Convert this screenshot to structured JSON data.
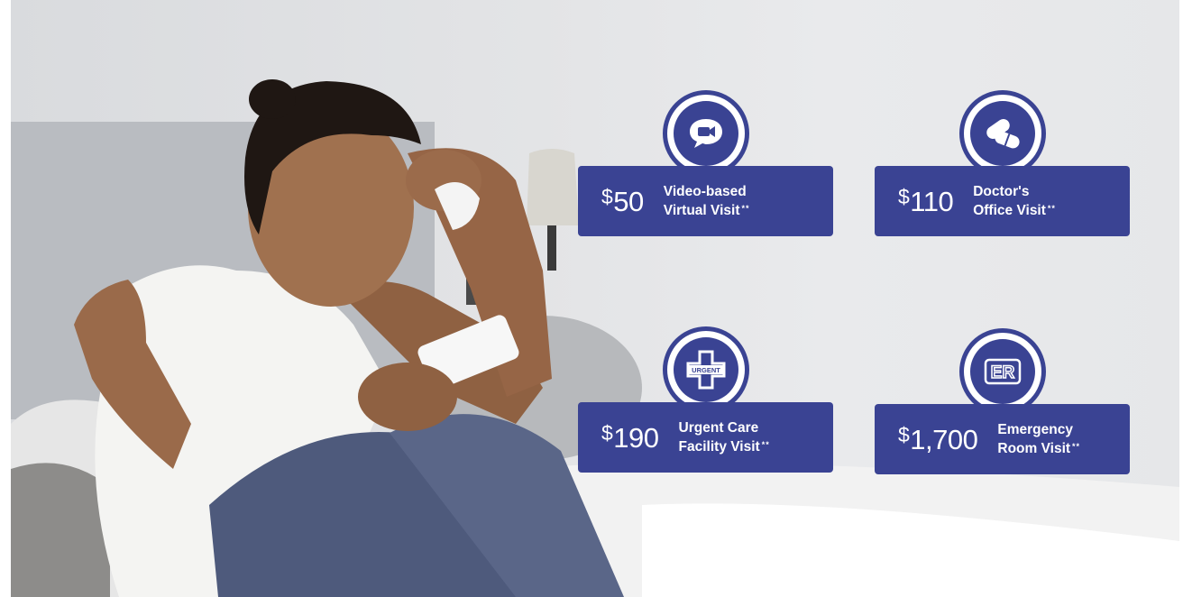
{
  "cards": [
    {
      "id": "video",
      "icon": "video-chat-icon",
      "currency": "$",
      "amount": "50",
      "line1": "Video-based",
      "line2": "Virtual Visit",
      "stars": "**"
    },
    {
      "id": "doctor",
      "icon": "pills-icon",
      "currency": "$",
      "amount": "110",
      "line1": "Doctor's",
      "line2": "Office Visit",
      "stars": "**"
    },
    {
      "id": "urgent",
      "icon": "urgent-cross-icon",
      "icon_text": "URGENT",
      "currency": "$",
      "amount": "190",
      "line1": "Urgent Care",
      "line2": "Facility Visit",
      "stars": "**"
    },
    {
      "id": "er",
      "icon": "er-icon",
      "icon_text": "ER",
      "currency": "$",
      "amount": "1,700",
      "line1": "Emergency",
      "line2": "Room Visit",
      "stars": "**"
    }
  ],
  "colors": {
    "brand": "#3a4393",
    "text_on_brand": "#ffffff"
  },
  "photo": {
    "subject": "woman-on-phone-photo"
  }
}
